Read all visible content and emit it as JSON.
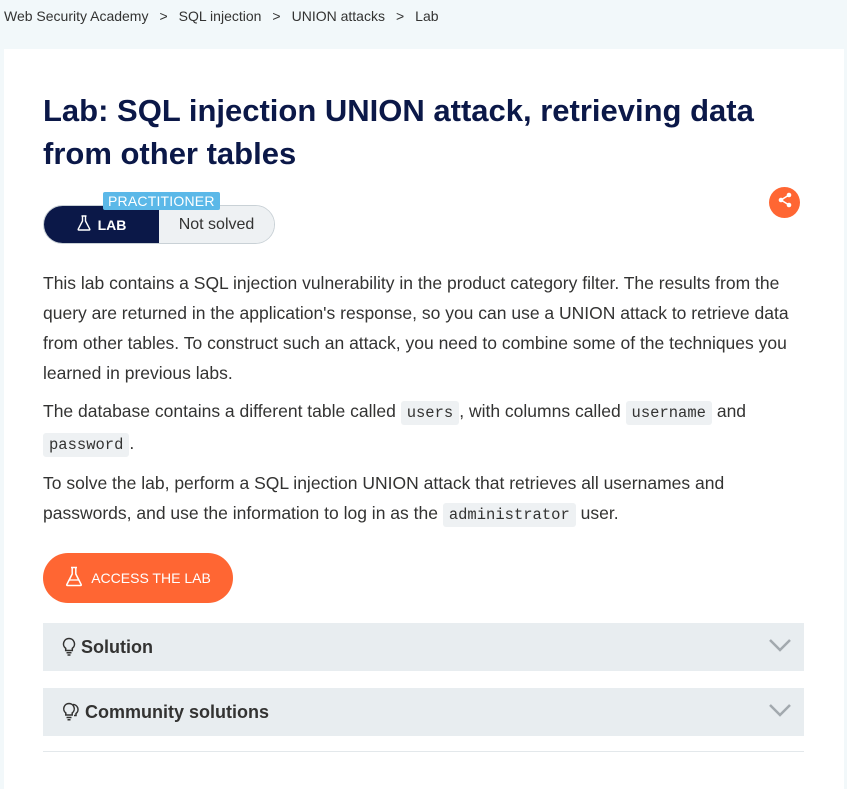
{
  "breadcrumb": {
    "items": [
      "Web Security Academy",
      "SQL injection",
      "UNION attacks",
      "Lab"
    ],
    "separator": ">"
  },
  "lab": {
    "title": "Lab: SQL injection UNION attack, retrieving data from other tables",
    "level": "PRACTITIONER",
    "type_label": "LAB",
    "status": "Not solved",
    "description": {
      "p1": "This lab contains a SQL injection vulnerability in the product category filter. The results from the query are returned in the application's response, so you can use a UNION attack to retrieve data from other tables. To construct such an attack, you need to combine some of the techniques you learned in previous labs.",
      "p2_a": "The database contains a different table called ",
      "p2_code1": "users",
      "p2_b": ", with columns called ",
      "p2_code2": "username",
      "p2_c": " and ",
      "p2_code3": "password",
      "p2_d": ".",
      "p3_a": "To solve the lab, perform a SQL injection UNION attack that retrieves all usernames and passwords, and use the information to log in as the ",
      "p3_code": "administrator",
      "p3_b": " user."
    },
    "access_button": "ACCESS THE LAB"
  },
  "accordions": {
    "solution": "Solution",
    "community": "Community solutions"
  },
  "icons": {
    "share": "share-icon",
    "flask": "flask-icon",
    "bulb": "lightbulb-icon",
    "community": "community-bulbs-icon",
    "chevron": "chevron-down-icon"
  },
  "colors": {
    "navy": "#0b1848",
    "orange": "#ff6633",
    "practitioner": "#5bb8e8",
    "page_bg": "#f2f8fa",
    "accordion_bg": "#e8edf0"
  }
}
